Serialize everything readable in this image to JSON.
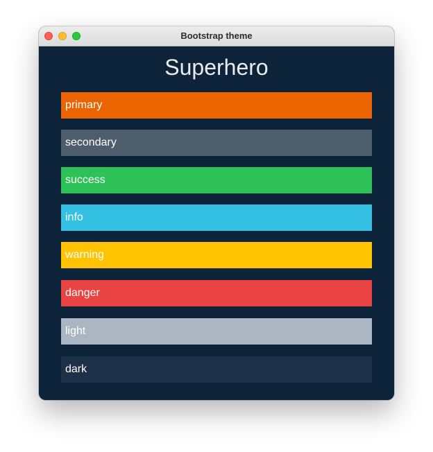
{
  "window": {
    "title": "Bootstrap theme"
  },
  "heading": "Superhero",
  "swatches": [
    {
      "label": "primary",
      "color": "#eb6400"
    },
    {
      "label": "secondary",
      "color": "#4e5d6c"
    },
    {
      "label": "success",
      "color": "#2dc158"
    },
    {
      "label": "info",
      "color": "#34c1e4"
    },
    {
      "label": "warning",
      "color": "#ffc300"
    },
    {
      "label": "danger",
      "color": "#e94343"
    },
    {
      "label": "light",
      "color": "#abb6c2"
    },
    {
      "label": "dark",
      "color": "#1e3048"
    }
  ],
  "colors": {
    "background": "#0c2339",
    "heading_text": "#ebebeb",
    "swatch_text": "#ffffff"
  },
  "icons": {
    "close": "close-traffic-light-icon",
    "minimize": "minimize-traffic-light-icon",
    "maximize": "maximize-traffic-light-icon"
  }
}
